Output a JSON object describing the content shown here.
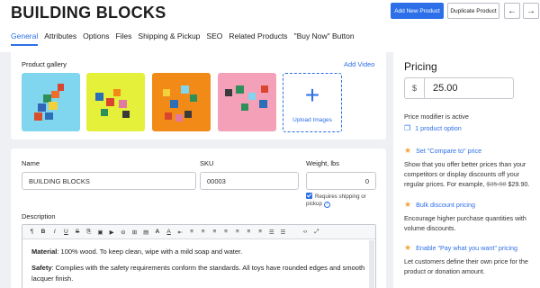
{
  "header": {
    "title": "BUILDING BLOCKS",
    "add_product": "Add New Product",
    "duplicate_product": "Duplicate Product",
    "prev_arrow": "←",
    "next_arrow": "→"
  },
  "tabs": [
    "General",
    "Attributes",
    "Options",
    "Files",
    "Shipping & Pickup",
    "SEO",
    "Related Products",
    "\"Buy Now\" Button"
  ],
  "gallery": {
    "label": "Product gallery",
    "add_video": "Add Video",
    "upload_label": "Upload Images",
    "thumb_colors": [
      "#7fd6ee",
      "#e4f03a",
      "#f28a17",
      "#f4a0b8"
    ]
  },
  "form": {
    "name_label": "Name",
    "name_value": "BUILDING BLOCKS",
    "sku_label": "SKU",
    "sku_value": "00003",
    "weight_label": "Weight, lbs",
    "weight_value": "0",
    "shipping_check": "Requires shipping or pickup",
    "description_label": "Description",
    "toolbar": [
      "¶",
      "B",
      "I",
      "U",
      "S",
      "⎘",
      "▣",
      "▶",
      "⊖",
      "⊞",
      "▤",
      "A",
      "A",
      "⇤",
      "≡",
      "≡",
      "≡",
      "≡",
      "≡",
      "≡",
      "≡",
      "☰",
      "☰",
      "‹›",
      "⤢"
    ],
    "desc_material_label": "Material",
    "desc_material_text": ": 100% wood. To keep clean, wipe with a mild soap and water.",
    "desc_safety_label": "Safety",
    "desc_safety_text": ": Complies with the safety requirements conform the standards. All toys have rounded edges and smooth lacquer finish."
  },
  "pricing": {
    "title": "Pricing",
    "currency": "$",
    "price": "25.00",
    "modifier_active": "Price modifier is active",
    "product_option": "1 product option",
    "compare_head": "Set \"Compare to\" price",
    "compare_text_1": "Show that you offer better prices than your competitors or display discounts off your regular prices. For example, ",
    "compare_old": "$35.90",
    "compare_new": " $29.90.",
    "bulk_head": "Bulk discount pricing",
    "bulk_text": "Encourage higher purchase quantities with volume discounts.",
    "pwyw_head": "Enable \"Pay what you want\" pricing",
    "pwyw_text": "Let customers define their own price for the product or donation amount."
  }
}
